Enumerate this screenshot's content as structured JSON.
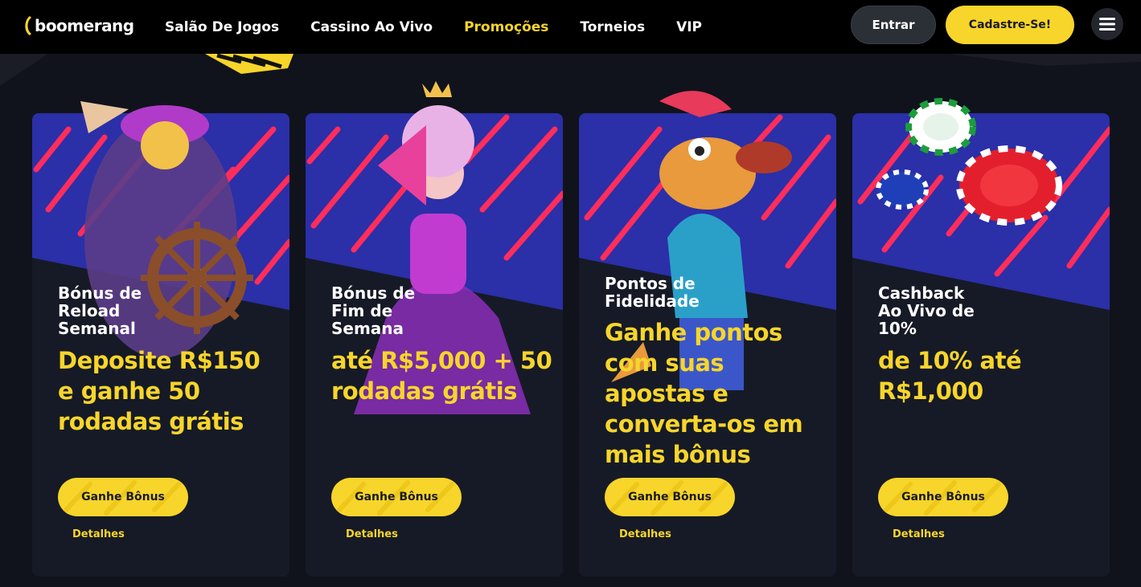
{
  "brand": {
    "name": "boomerang",
    "logo_icon": "boomerang-logo-icon",
    "accent": "#f7d52b"
  },
  "nav": {
    "items": [
      {
        "label": "Salão De Jogos",
        "active": false
      },
      {
        "label": "Cassino Ao Vivo",
        "active": false
      },
      {
        "label": "Promoções",
        "active": true
      },
      {
        "label": "Torneios",
        "active": false
      },
      {
        "label": "VIP",
        "active": false
      }
    ]
  },
  "header": {
    "login_label": "Entrar",
    "signup_label": "Cadastre-Se!",
    "menu_icon": "hamburger-menu-icon"
  },
  "promotions": [
    {
      "title": "Bónus de\nReload\nSemanal",
      "offer": "Deposite R$150 e ganhe 50 rodadas grátis",
      "cta": "Ganhe Bônus",
      "details": "Detalhes",
      "art": "pirate-captain-illustration"
    },
    {
      "title": "Bónus de\nFim de\nSemana",
      "offer": "até R$5,000 + 50 rodadas grátis",
      "cta": "Ganhe Bônus",
      "details": "Detalhes",
      "art": "baroque-queen-illustration"
    },
    {
      "title": "Pontos de\nFidelidade",
      "offer": "Ganhe pontos com suas apostas e converta-os em mais bônus",
      "cta": "Ganhe Bônus",
      "details": "Detalhes",
      "art": "cartoon-wolf-illustration"
    },
    {
      "title": "Cashback\nAo Vivo de\n10%",
      "offer": "de 10% até R$1,000",
      "cta": "Ganhe Bônus",
      "details": "Detalhes",
      "art": "casino-chips-illustration"
    }
  ]
}
